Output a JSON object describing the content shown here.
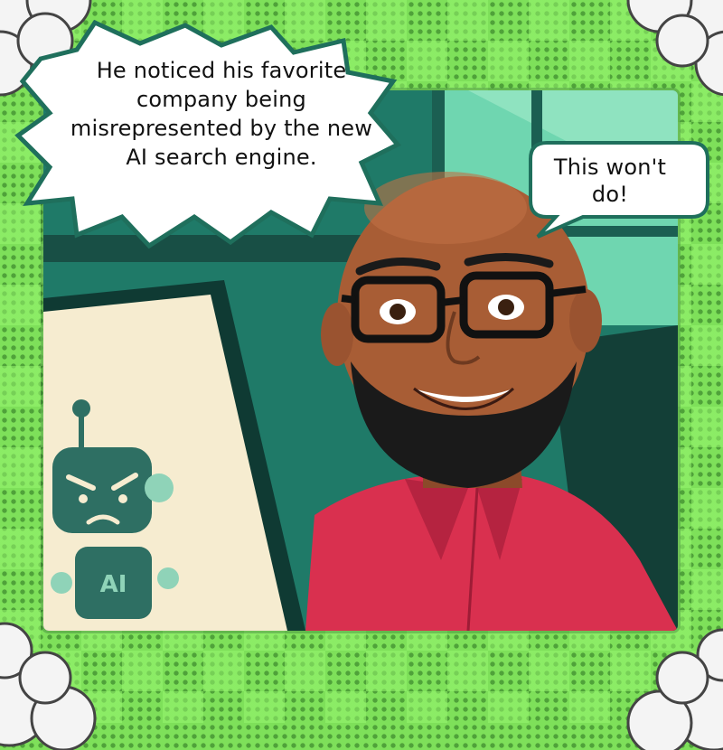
{
  "narration": {
    "text": "He noticed his favorite company being misrepresented by the new AI search engine."
  },
  "speech": {
    "text": "This won't do!"
  },
  "screen": {
    "robot_badge": "AI"
  },
  "colors": {
    "background_green": "#7ee05a",
    "panel_teal": "#1f7a68",
    "shirt_red": "#d9304f",
    "screen_cream": "#f6ecd0",
    "robot_teal": "#2e6f63"
  },
  "icons": [
    "robot-icon",
    "cloud-decoration"
  ]
}
